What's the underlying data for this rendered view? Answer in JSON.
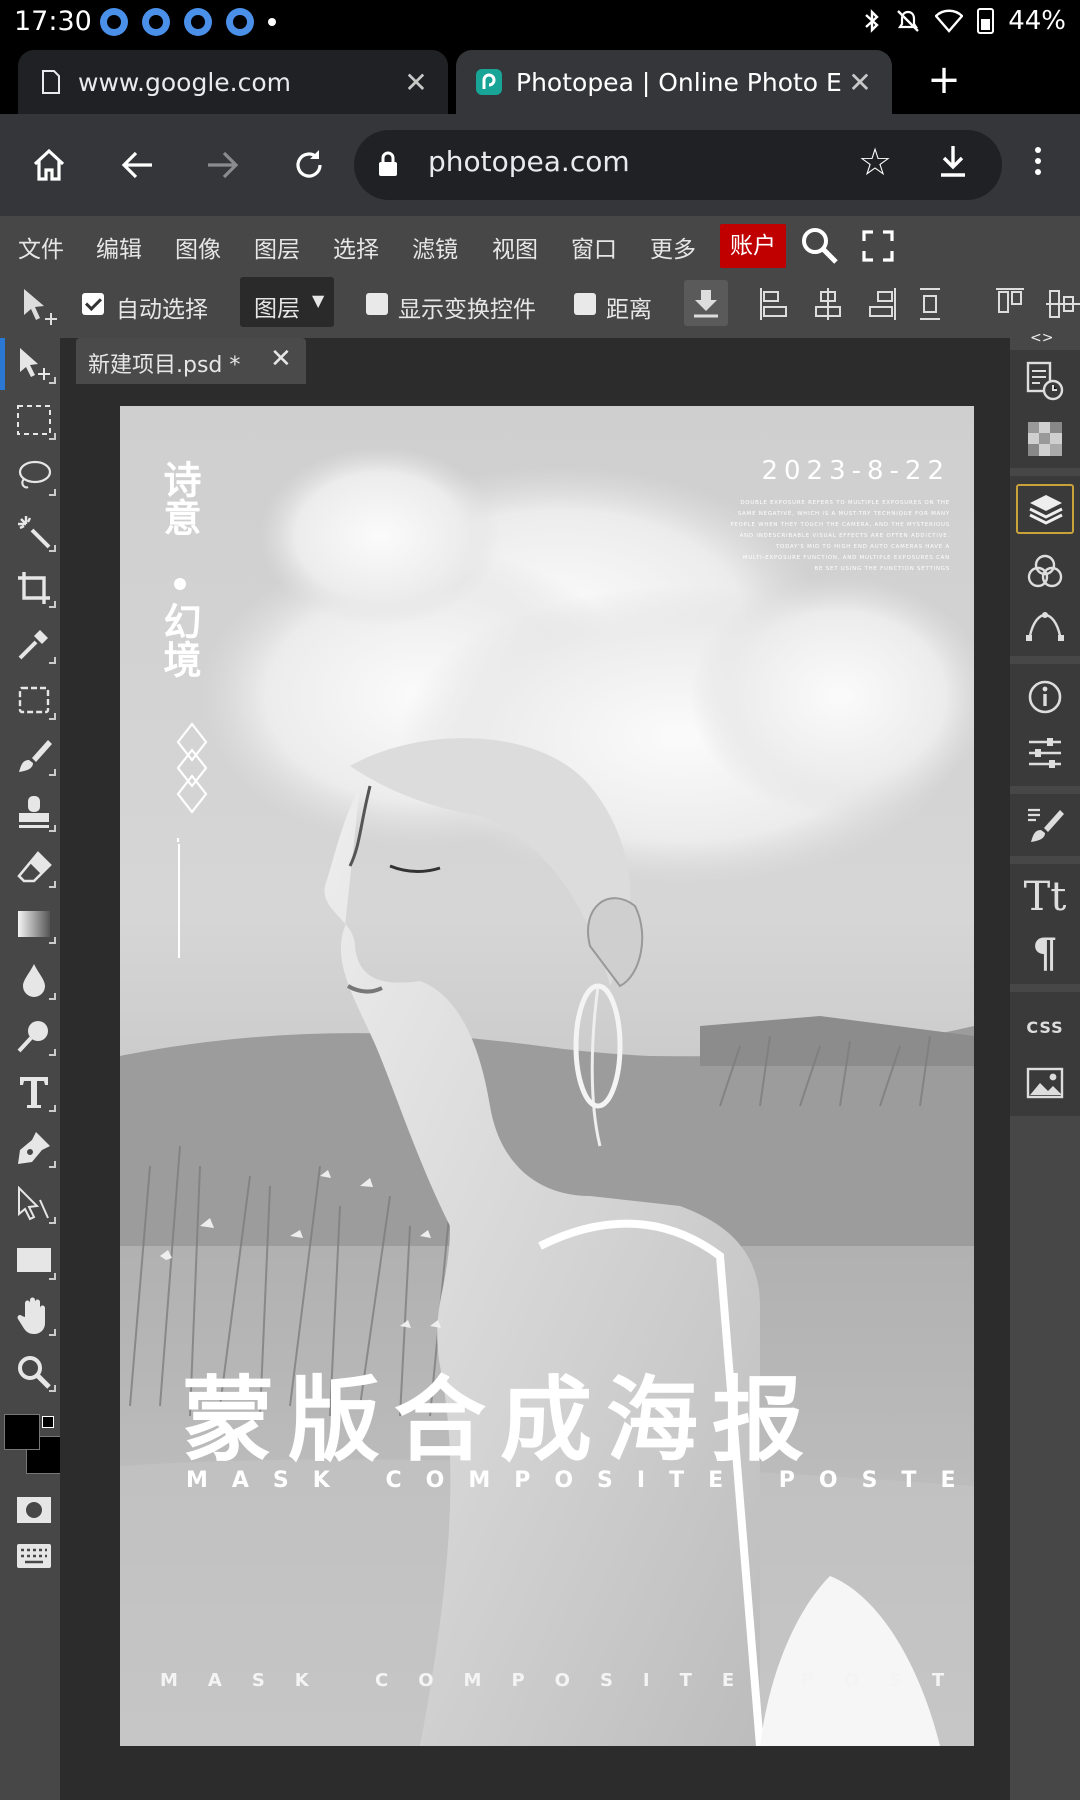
{
  "status_bar": {
    "time": "17:30",
    "battery": "44%"
  },
  "browser": {
    "tabs": [
      {
        "title": "www.google.com",
        "close": "✕"
      },
      {
        "title": "Photopea | Online Photo Edit",
        "close": "✕"
      }
    ],
    "new_tab": "+",
    "url": "photopea.com"
  },
  "menu": {
    "items": [
      "文件",
      "编辑",
      "图像",
      "图层",
      "选择",
      "滤镜",
      "视图",
      "窗口",
      "更多"
    ],
    "account": "账户"
  },
  "options": {
    "auto_select": "自动选择",
    "auto_select_checked": true,
    "layer_dropdown": "图层",
    "show_transform": "显示变换控件",
    "distance": "距离"
  },
  "document": {
    "tab_name": "新建项目.psd *",
    "close": "✕"
  },
  "panel_toggle": "<>",
  "css_label": "CSS",
  "poster": {
    "date": "2023-8-22",
    "blurb": [
      "DOUBLE EXPOSURE REFERS TO MULTIPLE EXPOSURES ON THE",
      "SAME NEGATIVE, WHICH IS A MUST-TRY TECHNIQUE FOR MANY",
      "PEOPLE WHEN THEY TOUCH THE CAMERA, AND THE MYSTERIOUS",
      "AND INDESCRIBABLE VISUAL EFFECTS ARE OFTEN ADDICTIVE.",
      "TODAY'S MID TO HIGH END AUTO CAMERAS HAVE A",
      "MULTI-EXPOSURE FUNCTION, AND MULTIPLE EXPOSURES CAN",
      "BE SET USING THE FUNCTION SETTINGS"
    ],
    "vertical_1": "诗意",
    "vertical_2": "幻境",
    "headline": "蒙版合成海报",
    "subtitle": "MASK COMPOSITE POSTER",
    "footer": "MASK COMPOSITE POSTER"
  }
}
